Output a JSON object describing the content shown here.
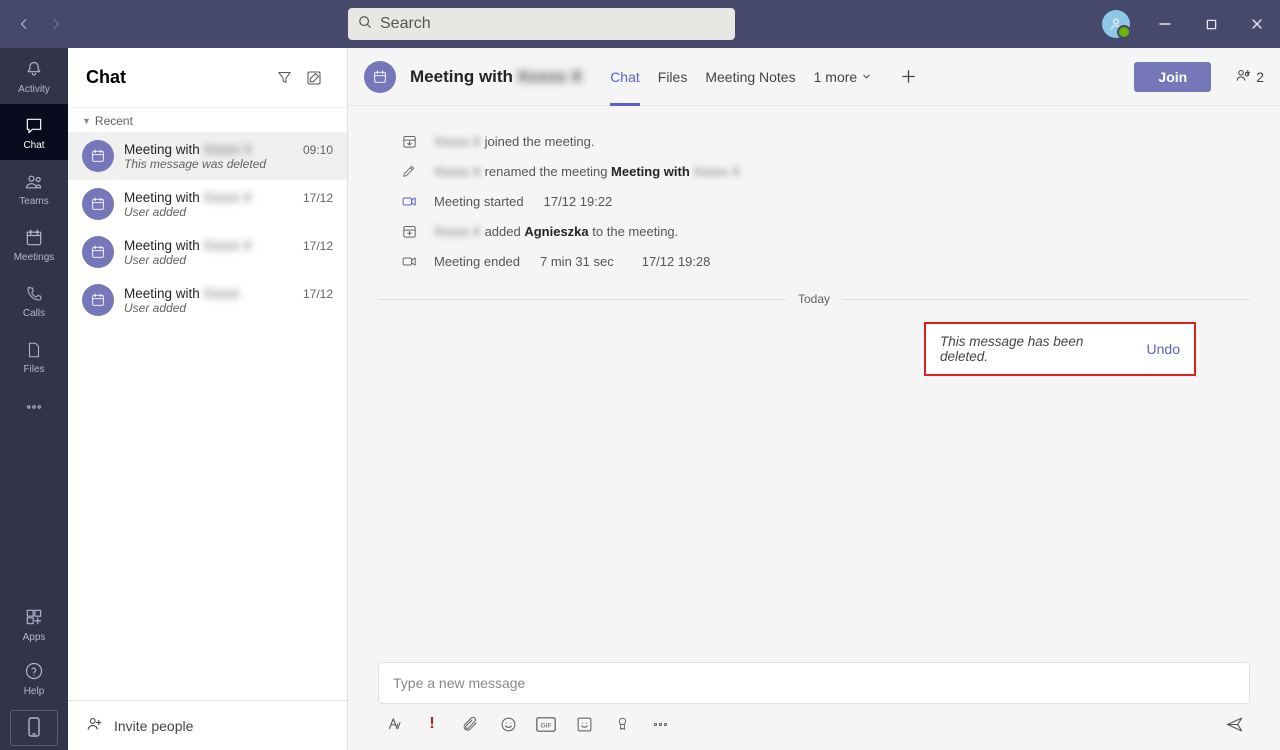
{
  "titlebar": {
    "search_placeholder": "Search",
    "participant_count": "2"
  },
  "rail": {
    "activity": "Activity",
    "chat": "Chat",
    "teams": "Teams",
    "meetings": "Meetings",
    "calls": "Calls",
    "files": "Files",
    "apps": "Apps",
    "help": "Help"
  },
  "listpane": {
    "title": "Chat",
    "section": "Recent",
    "invite": "Invite people",
    "items": [
      {
        "title_prefix": "Meeting with ",
        "title_blur": "Xxxxx X",
        "sub": "This message was deleted",
        "time": "09:10",
        "selected": true
      },
      {
        "title_prefix": "Meeting with ",
        "title_blur": "Xxxxx X",
        "sub": "User added",
        "time": "17/12"
      },
      {
        "title_prefix": "Meeting with ",
        "title_blur": "Xxxxx X",
        "sub": "User added",
        "time": "17/12"
      },
      {
        "title_prefix": "Meeting with ",
        "title_blur": "Xxxxx",
        "sub": "User added",
        "time": "17/12"
      }
    ]
  },
  "header": {
    "title_prefix": "Meeting with ",
    "title_blur": "Xxxxx X",
    "tabs": {
      "chat": "Chat",
      "files": "Files",
      "notes": "Meeting Notes",
      "more": "1 more"
    },
    "join": "Join"
  },
  "sys": {
    "joined_name": "Xxxxx X",
    "joined_suffix": " joined the meeting.",
    "renamed_name": "Xxxxx X",
    "renamed_mid": " renamed the meeting ",
    "renamed_bold": "Meeting with ",
    "renamed_blur": "Xxxxx X",
    "started": "Meeting started",
    "started_time": "17/12 19:22",
    "added_name": "Xxxxx X",
    "added_mid": " added ",
    "added_bold": "Agnieszka",
    "added_suffix": " to the meeting.",
    "ended": "Meeting ended",
    "ended_dur": "7 min 31 sec",
    "ended_time": "17/12 19:28"
  },
  "divider": {
    "today": "Today"
  },
  "deleted": {
    "text": "This message has been deleted.",
    "undo": "Undo"
  },
  "compose": {
    "placeholder": "Type a new message"
  }
}
